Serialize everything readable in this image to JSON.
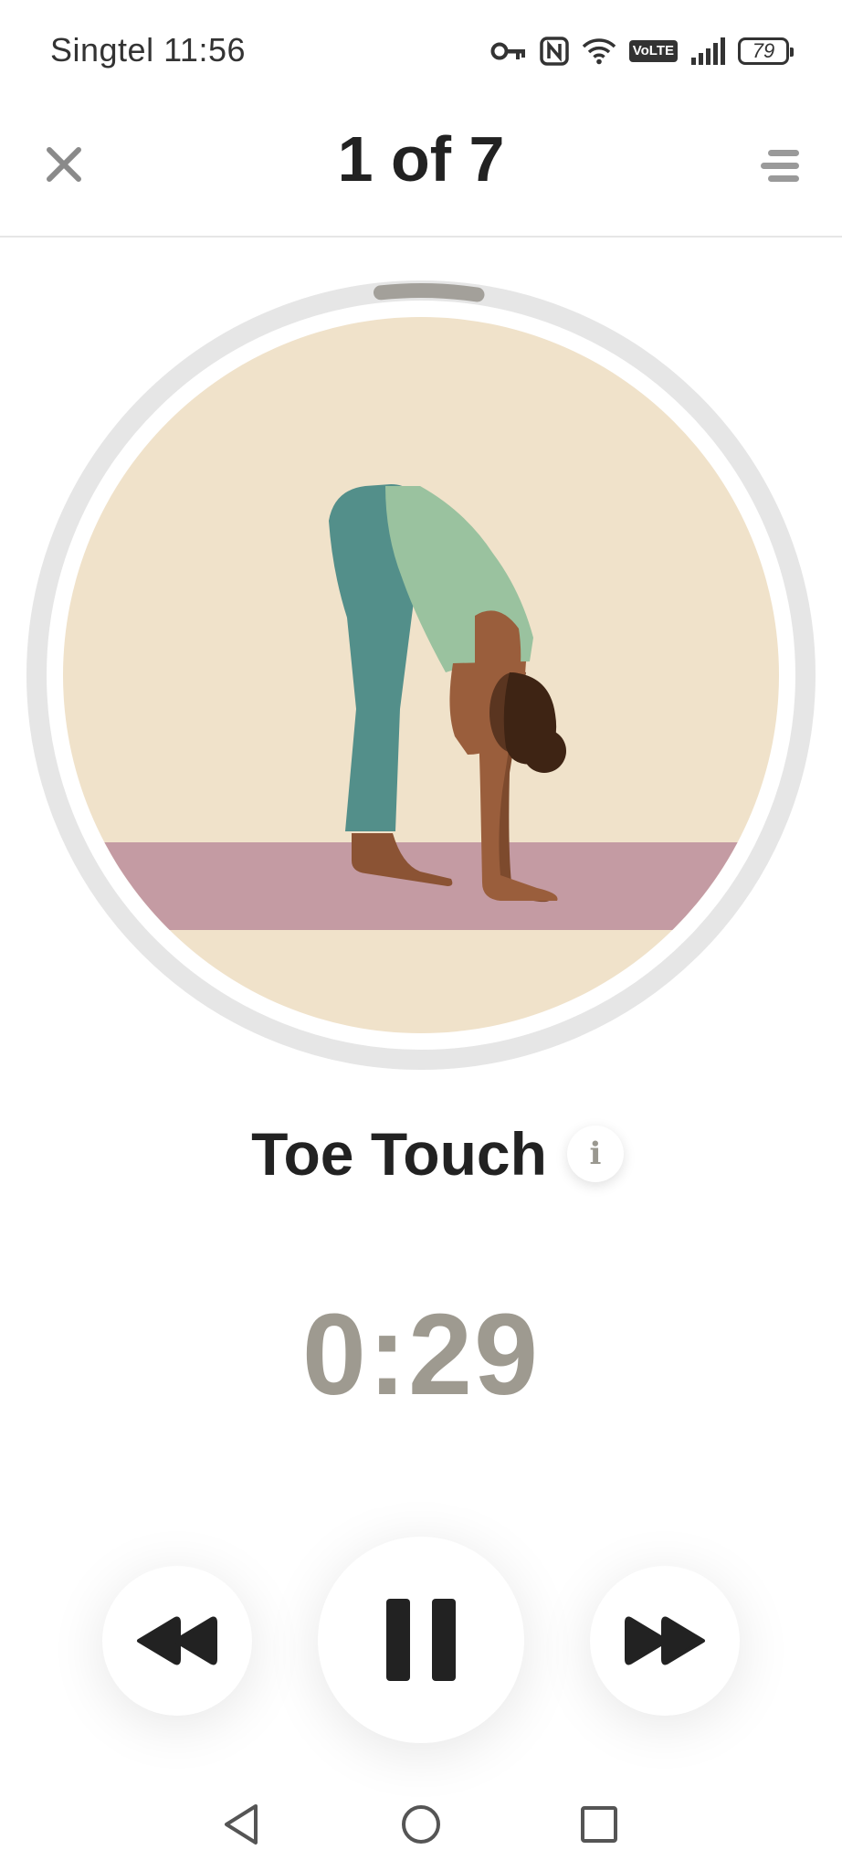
{
  "status_bar": {
    "carrier_time": "Singtel 11:56",
    "battery_level": "79",
    "volte_label": "VoLTE",
    "icons": [
      "vpn-key-icon",
      "nfc-icon",
      "wifi-icon",
      "volte-icon",
      "signal-icon",
      "battery-icon"
    ]
  },
  "header": {
    "title": "1 of 7",
    "close_icon": "close-icon",
    "list_icon": "list-icon"
  },
  "workout": {
    "current_index": 1,
    "total": 7,
    "step_progress": 0.04,
    "exercise_name": "Toe Touch",
    "info_label": "i",
    "timer": "0:29"
  },
  "controls": {
    "icons": [
      "rewind-icon",
      "pause-icon",
      "fast-forward-icon"
    ]
  },
  "nav_bar": {
    "icons": [
      "back-icon",
      "home-icon",
      "recents-icon"
    ]
  },
  "colors": {
    "illustration_bg": "#f0e2ca",
    "mat": "#c49ba3",
    "ring_track": "#e6e6e6",
    "ring_progress": "#a3a09a",
    "leggings": "#538f8a",
    "shirt": "#9ac29f",
    "skin": "#9a5e3c",
    "hair": "#3e2414",
    "timer_text": "#9e9a90",
    "dark_text": "#222222"
  }
}
